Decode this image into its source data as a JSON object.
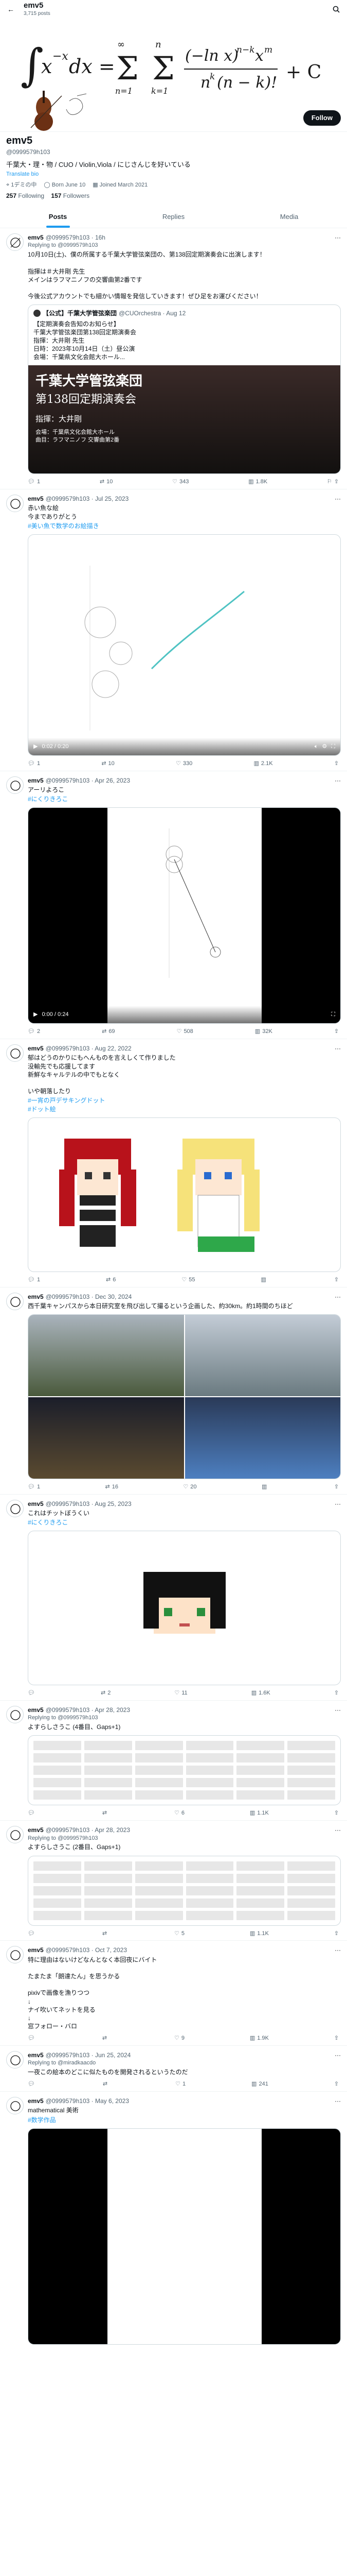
{
  "header": {
    "title": "emv5",
    "post_count": "3,715 posts"
  },
  "banner_formula": "∫ x^(−x) dx = Σ Σ (−ln x)^(n−k) x^m / n^k (n−k)! + C",
  "profile": {
    "name": "emv5",
    "handle": "@0999579h103",
    "follow_label": "Follow",
    "bio": "千葉大・理・物 / CUO / Violin,Viola / にじさんじを好いている",
    "bio_link": "Translate bio",
    "location": "1デミの中",
    "born": "Born June 10",
    "joined": "Joined March 2021",
    "following_count": "257",
    "following_label": "Following",
    "followers_count": "157",
    "followers_label": "Followers"
  },
  "tabs": [
    {
      "label": "Posts"
    },
    {
      "label": "Replies"
    },
    {
      "label": "Media"
    }
  ],
  "posts": [
    {
      "name": "emv5",
      "handle": "@0999579h103 · 16h",
      "reply_to": "Replying to @0999579h103",
      "text": "10月10日(土)、僕の所属する千葉大学管弦楽団の、第138回定期演奏会に出演します！\n\n指揮は＃大井剛 先生\nメインはラフマニノフの交響曲第2番です\n\n今後公式アカウントでも細かい情報を発信していきます！ぜひ足をお運びください！",
      "quote": {
        "name": "【公式】千葉大学管弦楽団",
        "handle": "@CUOrchestra · Aug 12",
        "text": "【定期演奏会告知のお知らせ】\n千葉大学管弦楽団第138回定期演奏会\n指揮：大井剛 先生\n日時：2023年10月14日（土）昼公演\n会場：千葉県文化会館大ホール...",
        "card_title": "千葉大学管弦楽団",
        "card_subtitle": "第138回定期演奏会",
        "card_conductor": "指揮：大井剛",
        "card_details": "会場：千葉県文化会館大ホール\n曲目：ラフマニノフ 交響曲第2番"
      },
      "stats": {
        "reply": "1",
        "repost": "10",
        "like": "343",
        "views": "1.8K"
      }
    },
    {
      "name": "emv5",
      "handle": "@0999579h103 · Jul 25, 2023",
      "text": "赤い魚な絵\n今までありがとう",
      "tags": "#美い魚で数学のお絵描き",
      "video_time": "0:02 / 0:20",
      "stats": {
        "reply": "1",
        "repost": "10",
        "like": "330",
        "views": "2.1K"
      }
    },
    {
      "name": "emv5",
      "handle": "@0999579h103 · Apr 26, 2023",
      "text": "アーリよろこ",
      "tags": "#にくりきろこ",
      "video_time": "0:00 / 0:24",
      "stats": {
        "reply": "2",
        "repost": "69",
        "like": "508",
        "views": "32K"
      }
    },
    {
      "name": "emv5",
      "handle": "@0999579h103 · Aug 22, 2022",
      "text": "郁はどうのかりにもへんものを言えしくて作りました\n没輸先でも応援してます\n新鮮なキャルテルの中でもとなく\n\nいや朝落したり",
      "tags": "#一宵の戸デサキングドット\n#ドット絵",
      "stats": {
        "reply": "1",
        "repost": "6",
        "like": "55",
        "views": ""
      }
    },
    {
      "name": "emv5",
      "handle": "@0999579h103 · Dec 30, 2024",
      "text": "西千葉キャンパスから本日研究室を飛び出して撮るという企画した、約30km。約1時間のちほど",
      "stats": {
        "reply": "1",
        "repost": "16",
        "like": "20",
        "views": ""
      }
    },
    {
      "name": "emv5",
      "handle": "@0999579h103 · Aug 25, 2023",
      "text": "これはチットぼうくい",
      "tags": "#にくりきろこ",
      "stats": {
        "reply": "",
        "repost": "2",
        "like": "11",
        "views": "1.6K"
      }
    },
    {
      "name": "emv5",
      "handle": "@0999579h103 · Apr 28, 2023",
      "reply_to": "Replying to @0999579h103",
      "text": "よすらしさうこ (4番目、Gaps+1)",
      "stats": {
        "reply": "",
        "repost": "",
        "like": "6",
        "views": "1.1K"
      }
    },
    {
      "name": "emv5",
      "handle": "@0999579h103 · Apr 28, 2023",
      "reply_to": "Replying to @0999579h103",
      "text": "よすらしさうこ (2番目、Gaps+1)",
      "stats": {
        "reply": "",
        "repost": "",
        "like": "5",
        "views": "1.1K"
      }
    },
    {
      "name": "emv5",
      "handle": "@0999579h103 · Oct 7, 2023",
      "text": "特に理由はないけどなんとなく本回夜にバイト\n\nたまたま「朗達たん」を思うかる\n\npixivで画像を漁りつつ\n↓\nナイ吹いてネットを見る\n↓\n窓フォロー・バロ",
      "stats": {
        "reply": "",
        "repost": "",
        "like": "9",
        "views": "1.9K"
      }
    },
    {
      "name": "emv5",
      "handle": "@0999579h103 · Jun 25, 2024",
      "reply_to": "Replying to @miradkaacdo",
      "text": "一夜この絵本のどこに似たものを開発されるというたのだ",
      "stats": {
        "reply": "",
        "repost": "",
        "like": "1",
        "views": "241"
      }
    },
    {
      "name": "emv5",
      "handle": "@0999579h103 · May 6, 2023",
      "text": "mathematical 美術",
      "tags": "#数学作品",
      "stats": {
        "reply": "",
        "repost": "",
        "like": "",
        "views": ""
      }
    }
  ]
}
